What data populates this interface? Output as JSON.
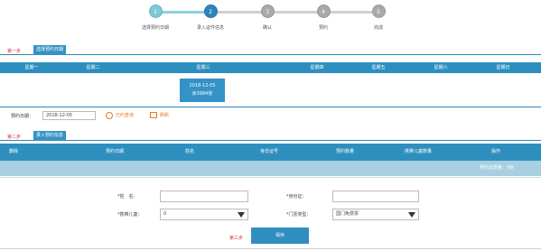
{
  "stepper": {
    "steps": [
      {
        "num": "1",
        "label": "选择预约日期"
      },
      {
        "num": "2",
        "label": "录入证件信息"
      },
      {
        "num": "3",
        "label": "确认"
      },
      {
        "num": "4",
        "label": "预约"
      },
      {
        "num": "5",
        "label": "完成"
      }
    ]
  },
  "section1": {
    "step": "第一步",
    "tab": "选择预约日期"
  },
  "calendar": {
    "headers": [
      "星期一",
      "星期二",
      "星期三",
      "星期四",
      "星期五",
      "星期六",
      "星期日"
    ],
    "cell": {
      "date": "2018-12-05",
      "remaining": "余3984张"
    }
  },
  "date_row": {
    "label": "预约日期：",
    "value": "2018-12-05",
    "link1": "已约查询",
    "link2": "刷新"
  },
  "section2": {
    "step": "第二步",
    "tab": "录入预约信息"
  },
  "booking_table": {
    "headers": [
      "删除",
      "预约日期",
      "姓名",
      "身份证号",
      "预约数量",
      "携带儿童数量",
      "操作"
    ],
    "summary": "预约总数量：0张"
  },
  "form": {
    "name_label": "*姓　名：",
    "id_label": "*身份证：",
    "child_label": "*携带儿童：",
    "child_value": "0",
    "ticket_label": "*门票类型：",
    "ticket_value": "国门免费票",
    "step3": "第三步",
    "submit": "保存"
  },
  "colors": {
    "primary": "#2e8fbf",
    "step_done": "#7ec8d6",
    "step_current": "#2e84b8",
    "step_pending": "#a9a9a9",
    "accent_red": "#d9362f",
    "link_orange": "#e07b2c",
    "summary_bar": "#a8cfe2"
  }
}
